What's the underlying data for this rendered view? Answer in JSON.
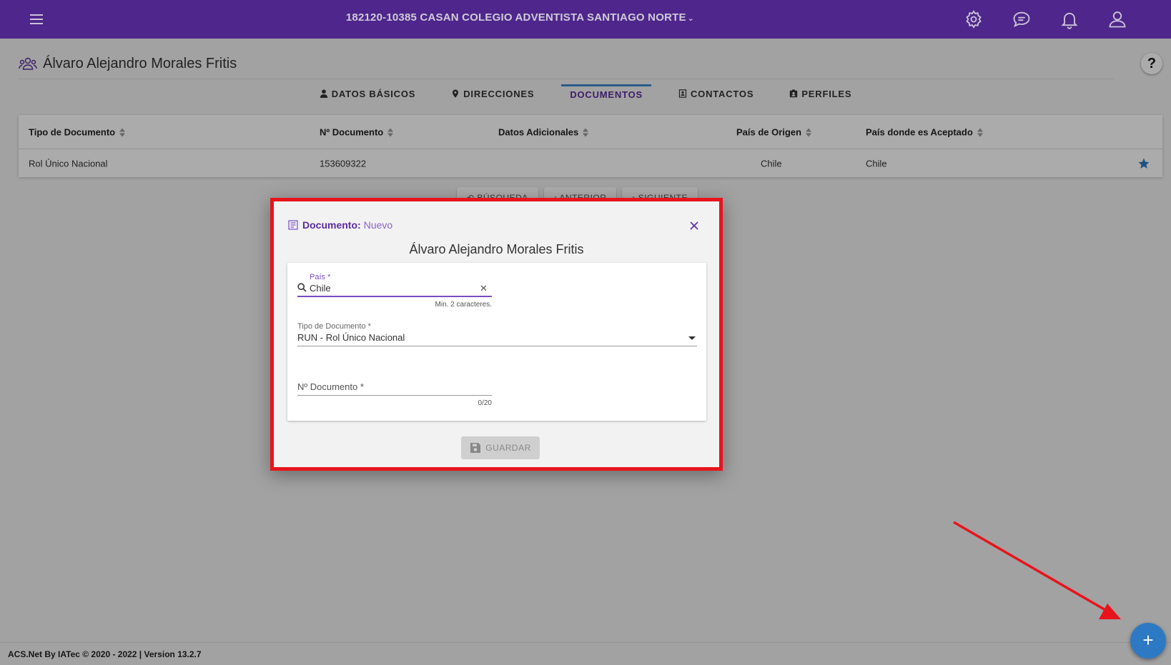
{
  "header": {
    "org_title": "182120-10385 CASAN COLEGIO ADVENTISTA SANTIAGO NORTE",
    "icons": [
      "menu-icon",
      "settings-icon",
      "chat-icon",
      "bell-icon",
      "user-icon"
    ],
    "color": "#5b2c9f"
  },
  "person": {
    "name": "Álvaro Alejandro Morales Fritis",
    "help": "?"
  },
  "tabs": [
    {
      "label": "DATOS BÁSICOS",
      "icon": "person-icon"
    },
    {
      "label": "DIRECCIONES",
      "icon": "map-pin-icon"
    },
    {
      "label": "DOCUMENTOS",
      "icon": "",
      "active": true
    },
    {
      "label": "CONTACTOS",
      "icon": "address-book-icon"
    },
    {
      "label": "PERFILES",
      "icon": "id-badge-icon"
    }
  ],
  "grid": {
    "columns": [
      "Tipo de Documento",
      "Nº Documento",
      "Datos Adicionales",
      "País de Origen",
      "País donde es Aceptado"
    ],
    "rows": [
      {
        "tipo": "Rol Único Nacional",
        "numero": "153609322",
        "datos": "",
        "origen": "Chile",
        "aceptado": "Chile",
        "favorite": true
      }
    ]
  },
  "pager": {
    "buttons": [
      "BÚSQUEDA",
      "ANTERIOR",
      "SIGUIENTE"
    ]
  },
  "dialog": {
    "label": "Documento:",
    "state": "Nuevo",
    "person_name": "Álvaro Alejandro Morales Fritis",
    "pais": {
      "label": "País *",
      "value": "Chile",
      "hint": "Min. 2 caracteres."
    },
    "tipo": {
      "label": "Tipo de Documento *",
      "value": "RUN - Rol Único Nacional"
    },
    "numero": {
      "label": "Nº Documento *",
      "counter": "0/20"
    },
    "save_label": "GUARDAR"
  },
  "footer": {
    "text": "ACS.Net By IATec © 2020 - 2022 | Version 13.2.7"
  },
  "fab": {
    "label": "+",
    "color": "#2d79c4"
  },
  "annotation": {
    "box_color": "#e8141c"
  }
}
